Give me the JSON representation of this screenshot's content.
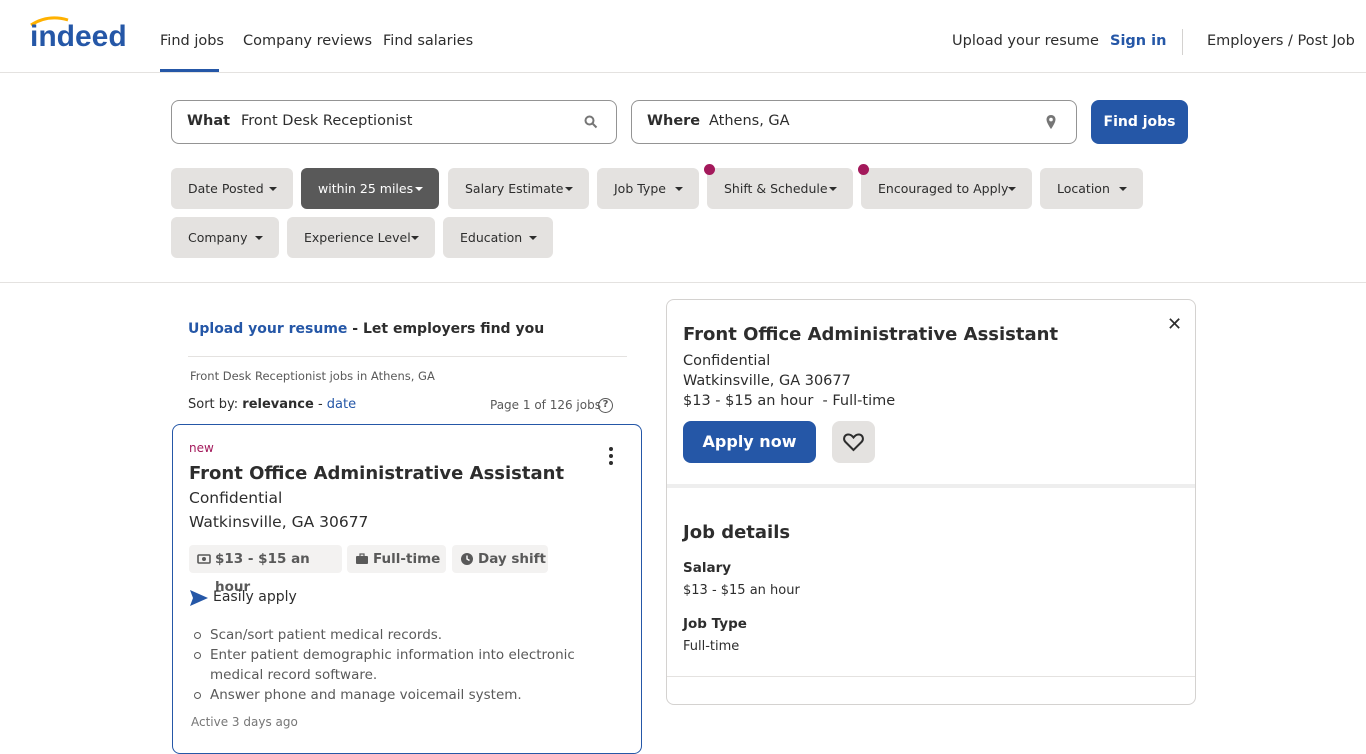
{
  "header": {
    "logo_text": "indeed",
    "nav": [
      "Find jobs",
      "Company reviews",
      "Find salaries"
    ],
    "upload_resume": "Upload your resume",
    "sign_in": "Sign in",
    "employers": "Employers / Post Job"
  },
  "search": {
    "what_label": "What",
    "what_value": "Front Desk Receptionist",
    "where_label": "Where",
    "where_value": "Athens, GA",
    "find_button": "Find jobs"
  },
  "filters": [
    {
      "label": "Date Posted",
      "active": false,
      "dot": false
    },
    {
      "label": "within 25 miles",
      "active": true,
      "dot": false
    },
    {
      "label": "Salary Estimate",
      "active": false,
      "dot": false
    },
    {
      "label": "Job Type",
      "active": false,
      "dot": false
    },
    {
      "label": "Shift & Schedule",
      "active": false,
      "dot": true
    },
    {
      "label": "Encouraged to Apply",
      "active": false,
      "dot": true
    },
    {
      "label": "Location",
      "active": false,
      "dot": false
    },
    {
      "label": "Company",
      "active": false,
      "dot": false
    },
    {
      "label": "Experience Level",
      "active": false,
      "dot": false
    },
    {
      "label": "Education",
      "active": false,
      "dot": false
    }
  ],
  "results": {
    "upload_link": "Upload your resume",
    "upload_rest": " - Let employers find you",
    "breadcrumb": "Front Desk Receptionist jobs in Athens, GA",
    "sort_prefix": "Sort by: ",
    "sort_active": "relevance",
    "sort_sep": " - ",
    "sort_other": "date",
    "page_count": "Page 1 of 126 jobs",
    "help_glyph": "?"
  },
  "job_card": {
    "tag": "new",
    "title": "Front Office Administrative Assistant",
    "company": "Confidential",
    "location": "Watkinsville, GA 30677",
    "salary": "$13 - $15 an hour",
    "job_type": "Full-time",
    "shift": "Day shift",
    "easily_apply": "Easily apply",
    "bullets": [
      "Scan/sort patient medical records.",
      "Enter patient demographic information into electronic medical record software.",
      "Answer phone and manage voicemail system."
    ],
    "active": "Active 3 days ago"
  },
  "detail_pane": {
    "title": "Front Office Administrative Assistant",
    "company": "Confidential",
    "location": "Watkinsville, GA 30677",
    "pay_line": "$13 - $15 an hour  - Full-time",
    "close_glyph": "✕",
    "apply_button": "Apply now",
    "details_heading": "Job details",
    "salary_label": "Salary",
    "salary_value": "$13 - $15 an hour",
    "jobtype_label": "Job Type",
    "jobtype_value": "Full-time"
  },
  "colors": {
    "brand_blue": "#2557a7",
    "accent_magenta": "#a3195b",
    "logo_yellow": "#ffb100"
  }
}
